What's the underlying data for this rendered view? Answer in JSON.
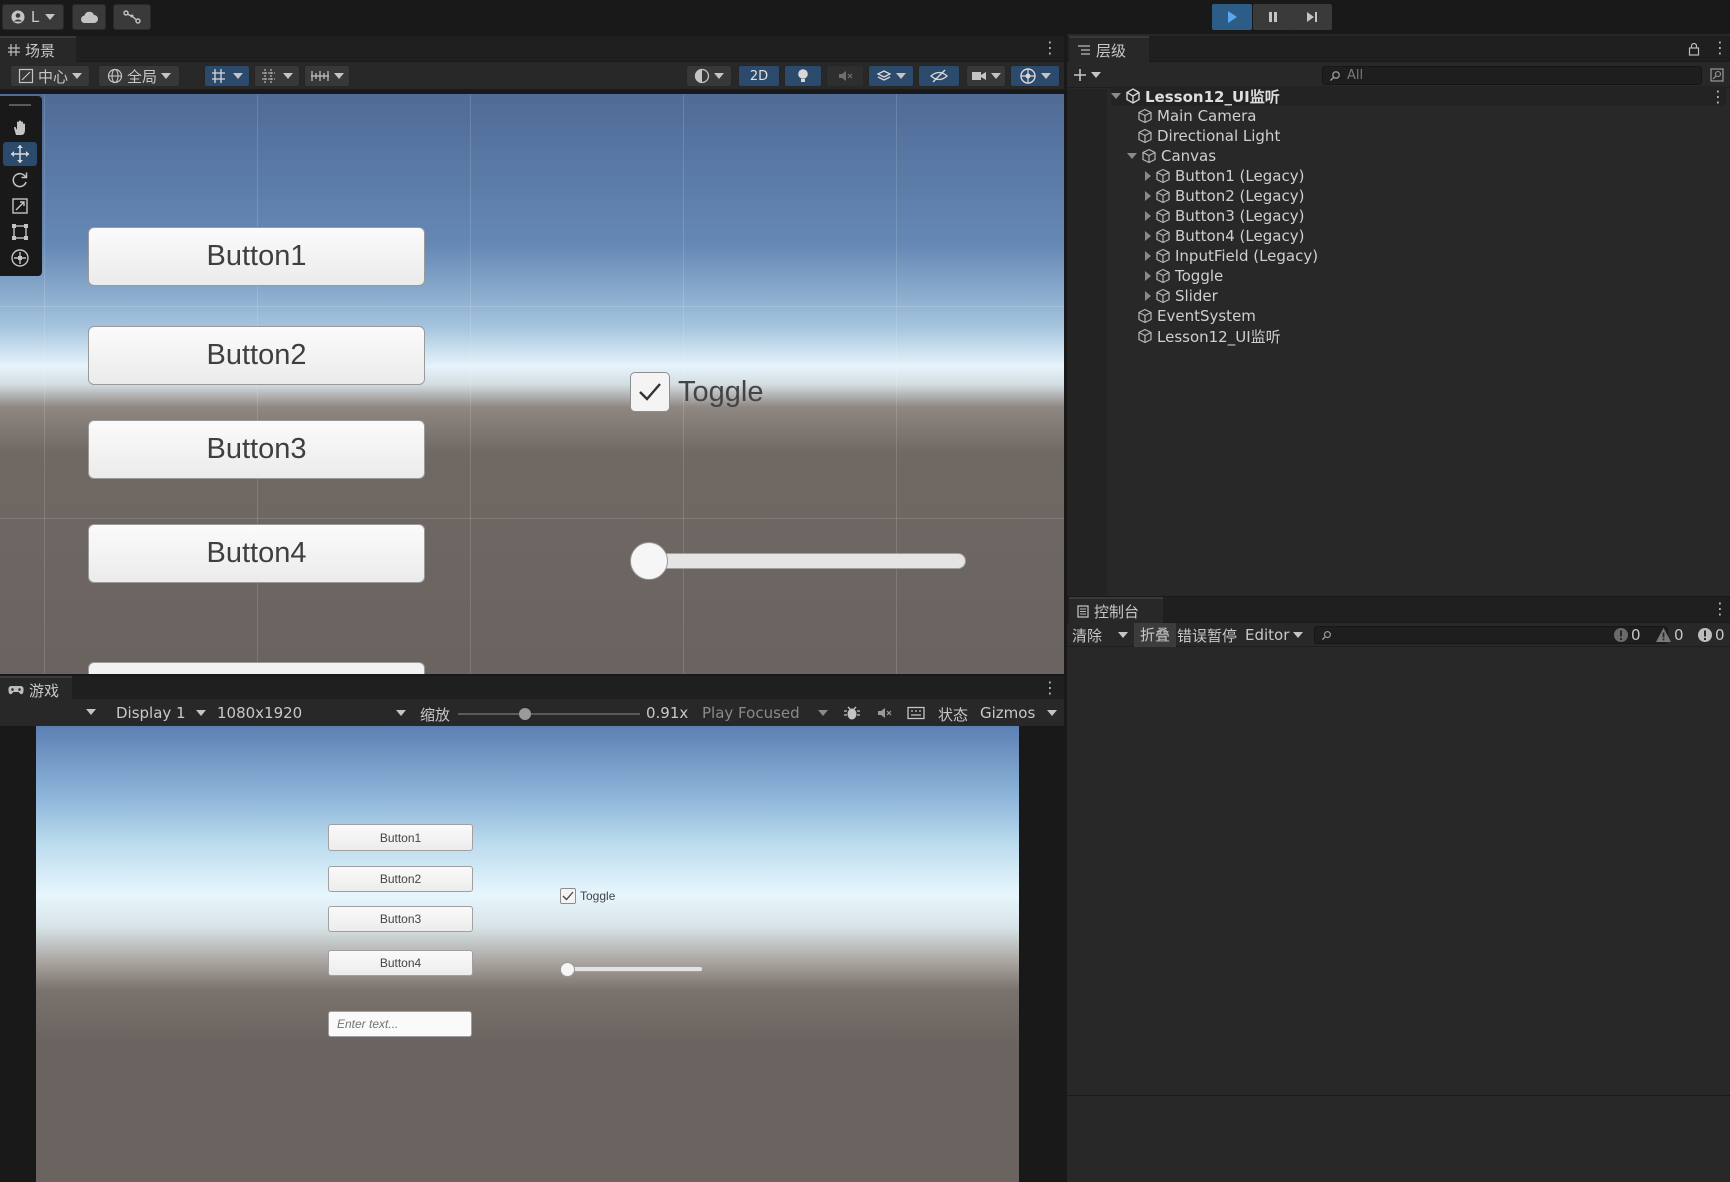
{
  "topbar": {
    "account_label": "L",
    "cloud_icon": "cloud-icon",
    "collab_icon": "branch-icon",
    "play_icon": "play-icon",
    "pause_icon": "pause-icon",
    "step_icon": "step-icon"
  },
  "scene_panel": {
    "tab_label": "场景",
    "pivot_label": "中心",
    "space_label": "全局",
    "mode_2d_label": "2D",
    "viewport": {
      "buttons": [
        "Button1",
        "Button2",
        "Button3",
        "Button4"
      ],
      "toggle_label": "Toggle",
      "toggle_checked": true,
      "slider_value": 0
    }
  },
  "game_panel": {
    "tab_label": "游戏",
    "display_label": "Display 1",
    "resolution_label": "1080x1920",
    "scale_label": "缩放",
    "scale_value": "0.91x",
    "play_mode_label": "Play Focused",
    "stats_label": "状态",
    "gizmos_label": "Gizmos",
    "viewport": {
      "buttons": [
        "Button1",
        "Button2",
        "Button3",
        "Button4"
      ],
      "toggle_label": "Toggle",
      "toggle_checked": true,
      "slider_value": 0,
      "input_placeholder": "Enter text..."
    }
  },
  "hierarchy": {
    "tab_label": "层级",
    "search_placeholder": "All",
    "scene_name": "Lesson12_UI监听",
    "items": [
      {
        "label": "Main Camera",
        "depth": 1,
        "expandable": false
      },
      {
        "label": "Directional Light",
        "depth": 1,
        "expandable": false
      },
      {
        "label": "Canvas",
        "depth": 1,
        "expandable": true,
        "expanded": true
      },
      {
        "label": "Button1 (Legacy)",
        "depth": 2,
        "expandable": true
      },
      {
        "label": "Button2 (Legacy)",
        "depth": 2,
        "expandable": true
      },
      {
        "label": "Button3 (Legacy)",
        "depth": 2,
        "expandable": true
      },
      {
        "label": "Button4 (Legacy)",
        "depth": 2,
        "expandable": true
      },
      {
        "label": "InputField (Legacy)",
        "depth": 2,
        "expandable": true
      },
      {
        "label": "Toggle",
        "depth": 2,
        "expandable": true
      },
      {
        "label": "Slider",
        "depth": 2,
        "expandable": true
      },
      {
        "label": "EventSystem",
        "depth": 1,
        "expandable": false
      },
      {
        "label": "Lesson12_UI监听",
        "depth": 1,
        "expandable": false
      }
    ]
  },
  "console": {
    "tab_label": "控制台",
    "clear_label": "清除",
    "collapse_label": "折叠",
    "error_pause_label": "错误暂停",
    "editor_label": "Editor",
    "info_count": "0",
    "warning_count": "0",
    "error_count": "0"
  },
  "colors": {
    "accent_blue": "#2c5d87",
    "panel_bg": "#282828",
    "header_bg": "#191919"
  }
}
